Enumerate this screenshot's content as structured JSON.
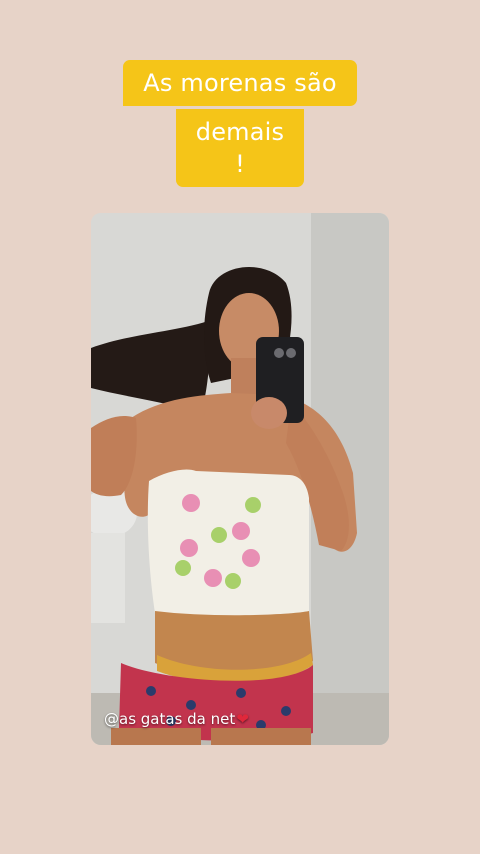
{
  "caption": {
    "line1": "As morenas são",
    "line2": "demais !"
  },
  "watermark": {
    "text": "@as gatas da net",
    "icon": "heart-icon"
  },
  "colors": {
    "background": "#e7d3c8",
    "caption_bg": "#f5c518",
    "caption_text": "#ffffff",
    "heart": "#e0283b"
  }
}
